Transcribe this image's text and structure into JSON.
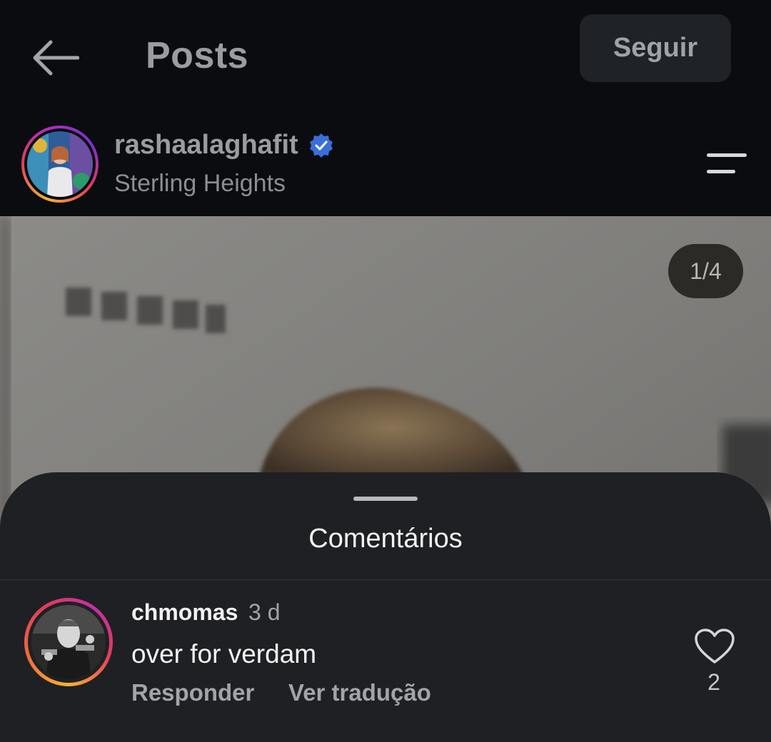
{
  "header": {
    "title": "Posts",
    "follow_label": "Seguir",
    "back_icon": "arrow-left-icon",
    "menu_icon": "menu-icon"
  },
  "post": {
    "username": "rashaalaghafit",
    "verified": true,
    "location": "Sterling Heights",
    "page_counter": "1/4"
  },
  "comments_sheet": {
    "title": "Comentários",
    "comments": [
      {
        "username": "chmomas",
        "time": "3 d",
        "text": "over for verdam",
        "reply_label": "Responder",
        "translate_label": "Ver tradução",
        "like_count": "2"
      }
    ]
  },
  "colors": {
    "background": "#0b0c0f",
    "sheet": "#1f2023",
    "verified_badge": "#3a6fd8"
  }
}
